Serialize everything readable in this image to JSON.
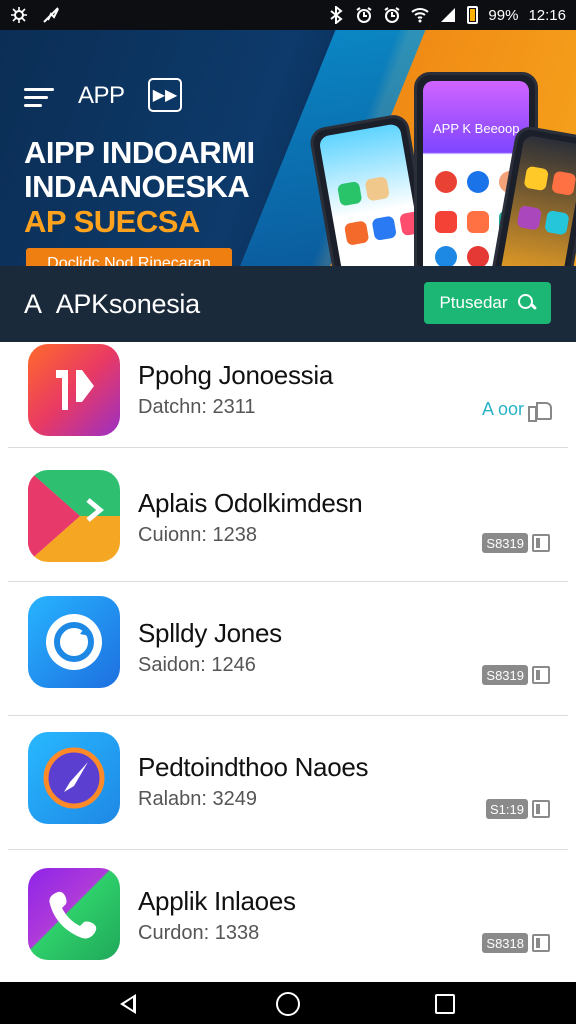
{
  "status_bar": {
    "battery": "99%",
    "time": "12:16"
  },
  "banner": {
    "app_label": "APP",
    "headline_1": "AIPP INDOARMI",
    "headline_2": "INDAANOESKA",
    "headline_3": "AP SUECSA",
    "cta_label": "Doclidc Nod Rinecaran",
    "phone_title": "APP K Beeoop",
    "accent_color": "#f08a14"
  },
  "section": {
    "title": "APKsonesia",
    "title_prefix": "A",
    "search_label": "Ptusedar"
  },
  "apps": [
    {
      "name": "Ppohg Jonoessia",
      "sub": "Datchn: 2311",
      "badge_type": "rate",
      "badge": "A oor"
    },
    {
      "name": "Aplais Odolkimdesn",
      "sub": "Cuionn: 1238",
      "badge_type": "box",
      "badge": "S8319"
    },
    {
      "name": "Splldy Jones",
      "sub": "Saidon: 1246",
      "badge_type": "box",
      "badge": "S8319"
    },
    {
      "name": "Pedtoindthoo Naoes",
      "sub": "Ralabn: 3249",
      "badge_type": "box",
      "badge": "S1:19"
    },
    {
      "name": "Applik Inlaoes",
      "sub": "Curdon: 1338",
      "badge_type": "box",
      "badge": "S8318"
    }
  ],
  "icons": {
    "app_1": "app-k-icon",
    "app_2": "play-store-icon",
    "app_3": "sync-icon",
    "app_4": "compass-icon",
    "app_5": "phone-icon"
  }
}
